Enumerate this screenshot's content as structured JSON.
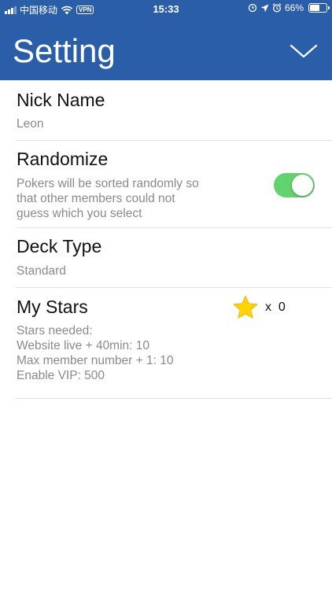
{
  "status_bar": {
    "carrier": "中国移动",
    "vpn": "VPN",
    "time": "15:33",
    "battery": "66%",
    "battery_level": 0.66
  },
  "header": {
    "title": "Setting"
  },
  "settings": {
    "nickname": {
      "title": "Nick Name",
      "value": "Leon"
    },
    "randomize": {
      "title": "Randomize",
      "description_lines": [
        "Pokers will be sorted randomly so",
        "that other members could not",
        "guess which you select"
      ],
      "enabled": true
    },
    "deck_type": {
      "title": "Deck Type",
      "value": "Standard"
    },
    "my_stars": {
      "title": "My Stars",
      "count": "x  0",
      "details": [
        "Stars needed:",
        "Website live + 40min: 10",
        "Max member number + 1: 10",
        "Enable VIP: 500"
      ]
    }
  },
  "colors": {
    "header": "#2a5ea8",
    "toggle_on": "#62d26f",
    "star": "#ffd400"
  },
  "icons": [
    "signal-icon",
    "wifi-icon",
    "location-icon",
    "alarm-icon",
    "battery-icon",
    "chevron-down-icon",
    "star-icon"
  ]
}
